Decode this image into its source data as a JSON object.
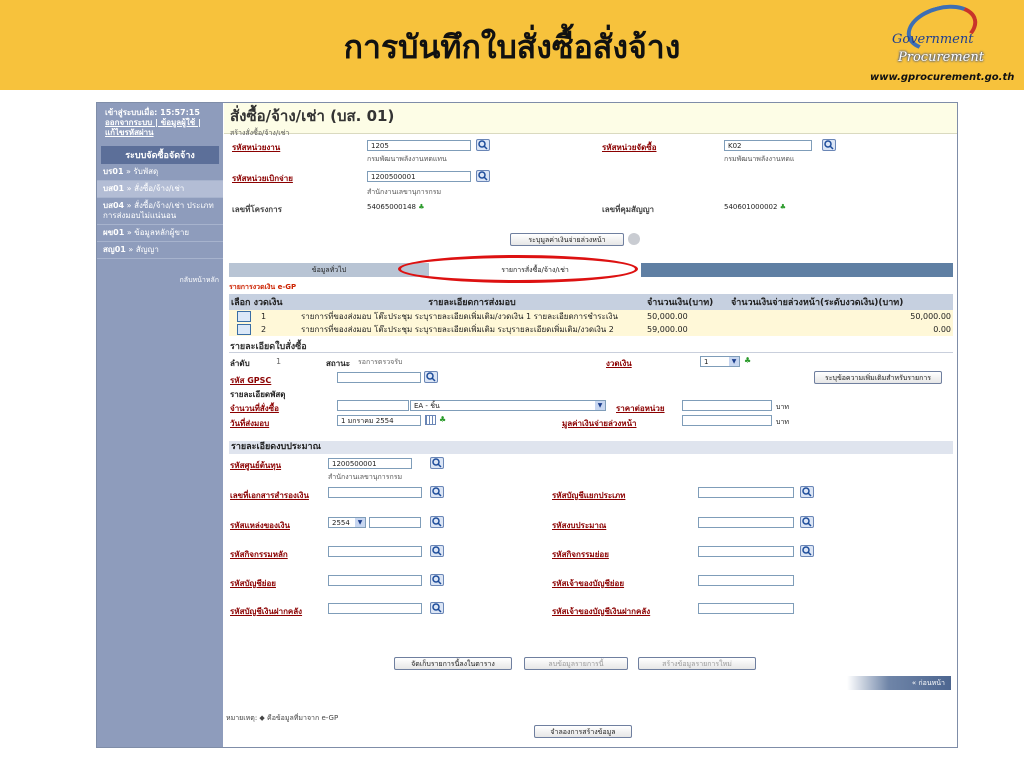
{
  "banner": {
    "title": "การบันทึกใบสั่งซื้อสั่งจ้าง",
    "logo_line1": "Government",
    "logo_line2": "Procurement",
    "logo_url": "www.gprocurement.go.th"
  },
  "sidebar": {
    "login_label": "เข้าสู่ระบบเมื่อ: 15:57:15",
    "login_links": "ออกจากระบบ | ข้อมูลผู้ใช้ | แก้ไขรหัสผ่าน",
    "section": "ระบบจัดซื้อจัดจ้าง",
    "items": [
      {
        "code": "บร01",
        "label": "รับพัสดุ"
      },
      {
        "code": "บส01",
        "label": "สั่งซื้อ/จ้าง/เช่า"
      },
      {
        "code": "บส04",
        "label": "สั่งซื้อ/จ้าง/เช่า ประเภทการส่งมอบไม่แน่นอน"
      },
      {
        "code": "ผข01",
        "label": "ข้อมูลหลักผู้ขาย"
      },
      {
        "code": "สญ01",
        "label": "สัญญา"
      }
    ],
    "back": "กลับหน้าหลัก"
  },
  "page": {
    "title": "สั่งซื้อ/จ้าง/เช่า (บส. 01)",
    "subtitle": "สร้างสั่งซื้อ/จ้าง/เช่า"
  },
  "header_form": {
    "agency_label": "รหัสหน่วยงาน",
    "agency_value": "1205",
    "agency_name": "กรมพัฒนาพลังงานทดแทน",
    "purchasing_unit_label": "รหัสหน่วยจัดซื้อ",
    "purchasing_unit_value": "K02",
    "purchasing_unit_name": "กรมพัฒนาพลังงานทดแ",
    "disbursing_unit_label": "รหัสหน่วยเบิกจ่าย",
    "disbursing_unit_value": "1200500001",
    "disbursing_unit_name": "สำนักงานเลขานุการกรม",
    "project_label": "เลขที่โครงการ",
    "project_value": "54065000148",
    "contract_label": "เลขที่คุมสัญญา",
    "contract_value": "540601000002",
    "advance_button": "ระบุมูลค่าเงินจ่ายล่วงหน้า"
  },
  "tabs": {
    "general": "ข้อมูลทั่วไป",
    "items": "รายการสั่งซื้อ/จ้าง/เช่า"
  },
  "installments": {
    "section_label": "รายการงวดเงิน e-GP",
    "columns": [
      "เลือก งวดเงิน",
      "รายละเอียดการส่งมอบ",
      "จำนวนเงิน(บาท)",
      "จำนวนเงินจ่ายล่วงหน้า(ระดับงวดเงิน)(บาท)"
    ],
    "rows": [
      {
        "no": "1",
        "detail": "รายการที่ของส่งมอบ โต๊ะประชุม ระบุรายละเอียดเพิ่มเติม/งวดเงิน 1 รายละเอียดการชำระเงิน",
        "amount": "50,000.00",
        "advance": "50,000.00"
      },
      {
        "no": "2",
        "detail": "รายการที่ของส่งมอบ โต๊ะประชุม ระบุรายละเอียดเพิ่มเติม ระบุรายละเอียดเพิ่มเติม/งวดเงิน 2",
        "amount": "59,000.00",
        "advance": "0.00"
      }
    ]
  },
  "po_detail": {
    "heading": "รายละเอียดใบสั่งซื้อ",
    "order_label": "ลำดับ",
    "order_value": "1",
    "status_label": "สถานะ",
    "status_value": "รอการตรวจรับ",
    "installment_label": "งวดเงิน",
    "installment_value": "1",
    "gpsc_label": "รหัส GPSC",
    "extra_button": "ระบุข้อความเพิ่มเติมสำหรับรายการ",
    "item_detail_label": "รายละเอียดพัสดุ",
    "qty_label": "จำนวนที่สั่งซื้อ",
    "unit_value": "EA - ชิ้น",
    "unit_price_label": "ราคาต่อหน่วย",
    "baht1": "บาท",
    "delivery_label": "วันที่ส่งมอบ",
    "delivery_value": "1 มกราคม 2554",
    "advance_label": "มูลค่าเงินจ่ายล่วงหน้า",
    "baht2": "บาท"
  },
  "budget": {
    "heading": "รายละเอียดงบประมาณ",
    "cost_center_label": "รหัสศูนย์ต้นทุน",
    "cost_center_value": "1200500001",
    "cost_center_name": "สำนักงานเลขานุการกรม",
    "reserve_doc_label": "เลขที่เอกสารสำรองเงิน",
    "gl_label": "รหัสบัญชีแยกประเภท",
    "fund_source_label": "รหัสแหล่งของเงิน",
    "fund_year": "2554",
    "budget_code_label": "รหัสงบประมาณ",
    "main_activity_label": "รหัสกิจกรรมหลัก",
    "sub_activity_label": "รหัสกิจกรรมย่อย",
    "sub_account_label": "รหัสบัญชีย่อย",
    "sub_account_owner_label": "รหัสเจ้าของบัญชีย่อย",
    "deposit_label": "รหัสบัญชีเงินฝากคลัง",
    "deposit_owner_label": "รหัสเจ้าของบัญชีเงินฝากคลัง"
  },
  "actions": {
    "save": "จัดเก็บรายการนี้ลงในตาราง",
    "delete": "ลบข้อมูลรายการนี้",
    "new": "สร้างข้อมูลรายการใหม่",
    "prev": "« ก่อนหน้า",
    "simulate": "จำลองการสร้างข้อมูล"
  },
  "footer_note": "หมายเหตุ: ◆ คือข้อมูลที่มาจาก e-GP"
}
